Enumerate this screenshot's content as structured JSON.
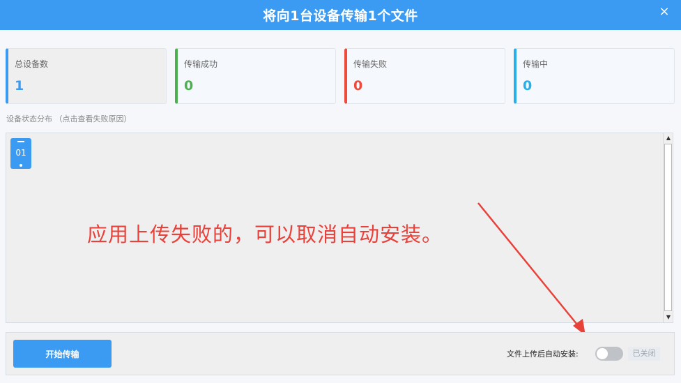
{
  "dialog": {
    "title": "将向1台设备传输1个文件",
    "close_label": "×"
  },
  "stats": [
    {
      "label": "总设备数",
      "value": "1",
      "color": "#3b9bf3"
    },
    {
      "label": "传输成功",
      "value": "0",
      "color": "#4caf50"
    },
    {
      "label": "传输失败",
      "value": "0",
      "color": "#f04a3a"
    },
    {
      "label": "传输中",
      "value": "0",
      "color": "#2aaee8"
    }
  ],
  "device_section": {
    "label": "设备状态分布 （点击查看失败原因）",
    "devices": [
      {
        "number": "01",
        "color": "#3b9bf3"
      }
    ]
  },
  "annotation": {
    "text": "应用上传失败的，可以取消自动安装。",
    "color": "#e8413a"
  },
  "footer": {
    "start_button": "开始传输",
    "auto_install_label": "文件上传后自动安装:",
    "toggle_status": "已关闭",
    "toggle_on": false
  },
  "scrollbar": {
    "up_icon": "▲",
    "down_icon": "▼"
  }
}
